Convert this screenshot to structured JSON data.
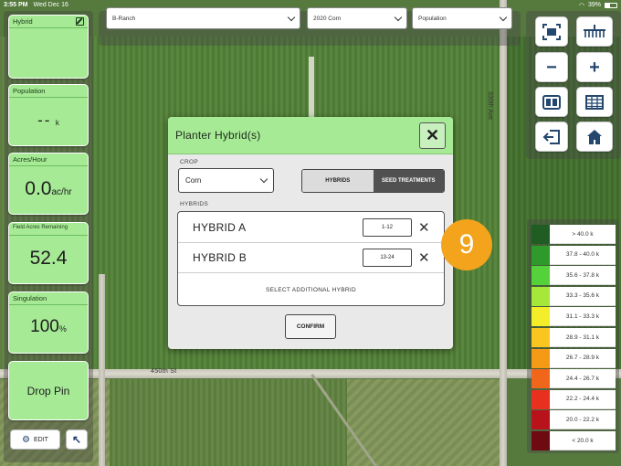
{
  "status_bar": {
    "time": "3:55 PM",
    "date": "Wed Dec 16",
    "battery": "39%"
  },
  "map": {
    "road_label": "450th St",
    "road_label_vertical": "330th Ave"
  },
  "tiles": {
    "hybrid": {
      "label": "Hybrid",
      "value": ""
    },
    "population": {
      "label": "Population",
      "value": "--",
      "unit": "k"
    },
    "acres_hour": {
      "label": "Acres/Hour",
      "value": "0.0",
      "unit": "ac/hr"
    },
    "field_acres": {
      "label": "Field Acres Remaining",
      "value": "52.4"
    },
    "singulation": {
      "label": "Singulation",
      "value": "100",
      "unit": "%"
    },
    "drop_pin": {
      "label": "Drop Pin"
    }
  },
  "bottom": {
    "edit_label": "EDIT"
  },
  "selectors": {
    "farm": "B-Ranch",
    "season": "2020 Corn",
    "layer": "Population"
  },
  "modal": {
    "title": "Planter Hybrid(s)",
    "crop_label": "CROP",
    "crop_value": "Corn",
    "toggle_hybrids": "HYBRIDS",
    "toggle_seed": "SEED TREATMENTS",
    "hybrids_label": "HYBRIDS",
    "hybrids": [
      {
        "name": "HYBRID A",
        "rows": "1-12"
      },
      {
        "name": "HYBRID B",
        "rows": "13-24"
      }
    ],
    "add_hybrid": "SELECT ADDITIONAL HYBRID",
    "confirm": "CONFIRM"
  },
  "step_badge": "9",
  "legend": {
    "items": [
      {
        "label": "> 40.0 k",
        "color": "#1f5d22"
      },
      {
        "label": "37.8 - 40.0 k",
        "color": "#2e9a2b"
      },
      {
        "label": "35.6 - 37.8 k",
        "color": "#55d13a"
      },
      {
        "label": "33.3 - 35.6 k",
        "color": "#a6e83a"
      },
      {
        "label": "31.1 - 33.3 k",
        "color": "#f4ee2a"
      },
      {
        "label": "28.9 - 31.1 k",
        "color": "#f9c61f"
      },
      {
        "label": "26.7 - 28.9 k",
        "color": "#f49a17"
      },
      {
        "label": "24.4 - 26.7 k",
        "color": "#f0661a"
      },
      {
        "label": "22.2 - 24.4 k",
        "color": "#e8301f"
      },
      {
        "label": "20.0 - 22.2 k",
        "color": "#b8131a"
      },
      {
        "label": "< 20.0 k",
        "color": "#6e0a12"
      }
    ]
  },
  "icons": {
    "fit_view": "fit-view-icon",
    "planter": "planter-icon",
    "zoom_out": "minus-icon",
    "zoom_in": "plus-icon",
    "split": "split-view-icon",
    "table": "table-icon",
    "exit": "exit-icon",
    "home": "home-icon"
  }
}
